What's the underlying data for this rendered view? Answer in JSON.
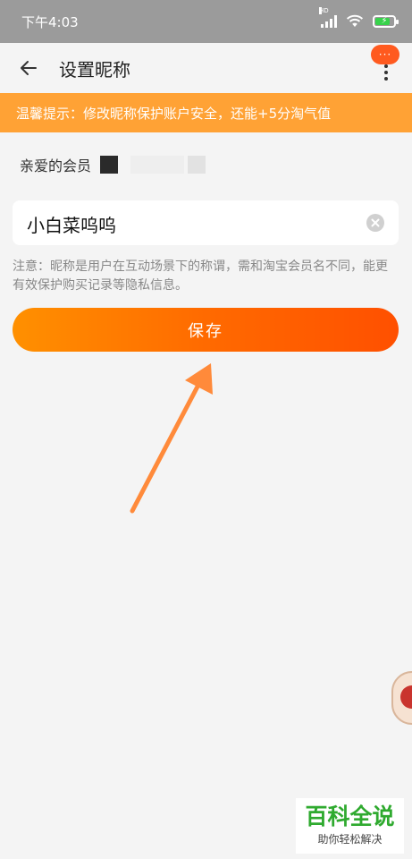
{
  "status_bar": {
    "time": "下午4:03",
    "signal_label": "HD",
    "icons": [
      "signal-icon",
      "wifi-icon",
      "battery-charging-icon"
    ]
  },
  "nav": {
    "title": "设置昵称",
    "back_icon": "back-arrow-icon",
    "more_badge": "···",
    "more_icon": "more-vertical-icon"
  },
  "tip": {
    "text": "温馨提示：修改昵称保护账户安全，还能+5分淘气值"
  },
  "member": {
    "label": "亲爱的会员"
  },
  "nickname_input": {
    "value": "小白菜呜呜",
    "clear_icon": "clear-icon"
  },
  "note": {
    "text": "注意：昵称是用户在互动场景下的称谓，需和淘宝会员名不同，能更有效保护购买记录等隐私信息。"
  },
  "save_button": {
    "label": "保存"
  },
  "watermark": {
    "main": "百科全说",
    "sub": "助你轻松解决"
  },
  "colors": {
    "status_bar": "#9b9b9b",
    "tip_banner": "#ffa235",
    "button_start": "#ff9000",
    "button_end": "#ff5000",
    "annotation_arrow": "#ff8a3a",
    "watermark_green": "#2faa2f"
  }
}
